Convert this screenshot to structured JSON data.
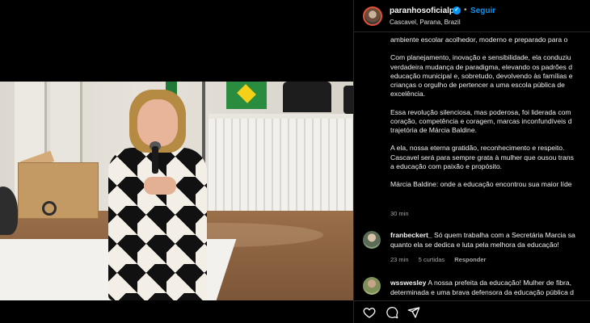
{
  "post": {
    "username": "paranhosoficialpr",
    "verified_mark": "✓",
    "separator": "•",
    "follow_label": "Seguir",
    "location": "Cascavel, Parana, Brazil",
    "caption_lines": [
      "ambiente escolar acolhedor, moderno e preparado para o",
      "",
      "Com planejamento, inovação e sensibilidade, ela conduziu",
      "verdadeira mudança de paradigma, elevando os padrões d",
      "educação municipal e, sobretudo, devolvendo às famílias e",
      "crianças o orgulho de pertencer a uma escola pública de",
      "excelência.",
      "",
      "Essa revolução silenciosa, mas poderosa, foi liderada com",
      "coração, competência e coragem, marcas inconfundíveis d",
      "trajetória de Márcia Baldine.",
      "",
      "A ela, nossa eterna gratidão, reconhecimento e respeito.",
      "Cascavel será para sempre grata à mulher que ousou trans",
      "a educação com paixão e propósito.",
      "",
      "Márcia Baldine: onde a educação encontrou sua maior líde"
    ],
    "time": "30 min"
  },
  "comments": [
    {
      "user": "franbeckert_",
      "line1": "Só quem trabalha com a Secretária Marcia sa",
      "line2": "quanto ela se dedica e luta pela melhora da educação!",
      "time": "23 min",
      "likes": "5 curtidas",
      "reply": "Responder"
    },
    {
      "user": "wsswesley",
      "line1": "A nossa prefeita da educação! Mulher de fibra,",
      "line2": "determinada e uma brava defensora da educação pública d"
    }
  ],
  "actions": {
    "icons": [
      "heart-icon",
      "comment-icon",
      "share-icon"
    ]
  }
}
